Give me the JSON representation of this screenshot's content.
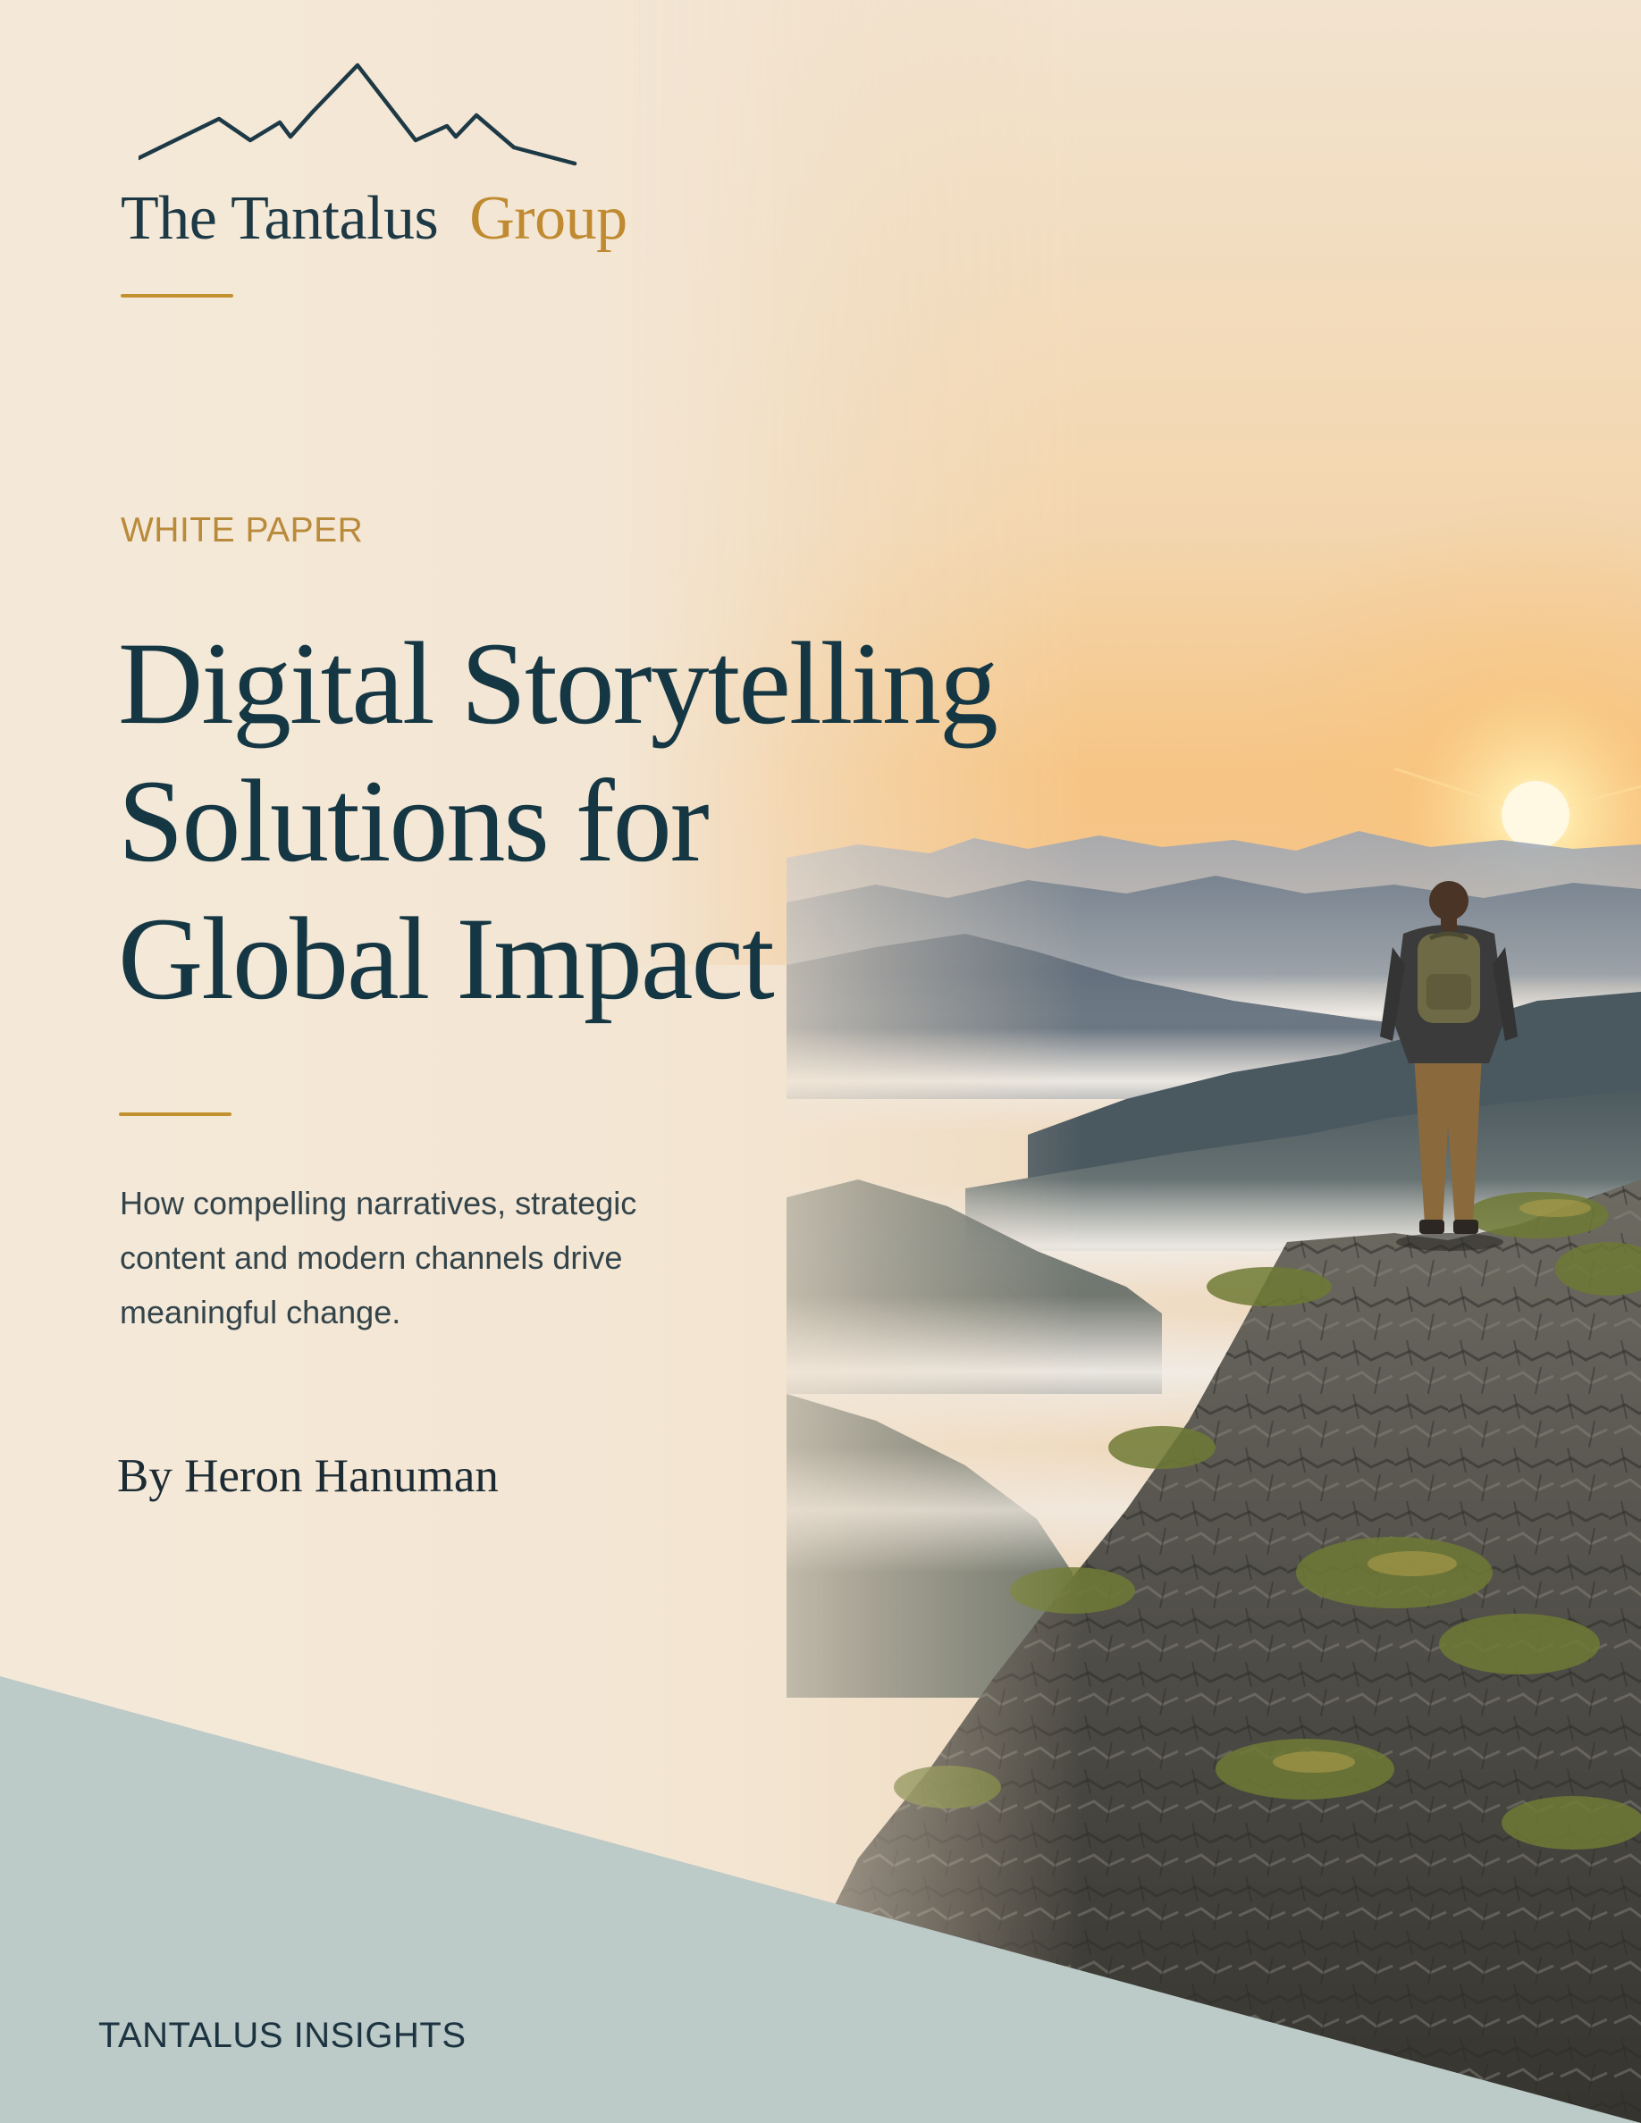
{
  "brand": {
    "name_main": "The Tantalus",
    "name_accent": "Group",
    "logo_icon": "mountain-range-icon",
    "colors": {
      "navy": "#1d3945",
      "gold": "#c08a31"
    }
  },
  "cover": {
    "eyebrow": "WHITE PAPER",
    "title_lines": [
      "Digital Storytelling",
      "Solutions for",
      "Global Impact"
    ],
    "summary_lines": [
      "How compelling narratives, strategic",
      "content and modern channels drive",
      "meaningful change."
    ],
    "byline": "By Heron Hanuman"
  },
  "footer": {
    "label": "TANTALUS INSIGHTS",
    "band_color": "#bccac8"
  },
  "photo": {
    "subject": "hiker standing on rocky summit at sunrise above misty valleys"
  }
}
